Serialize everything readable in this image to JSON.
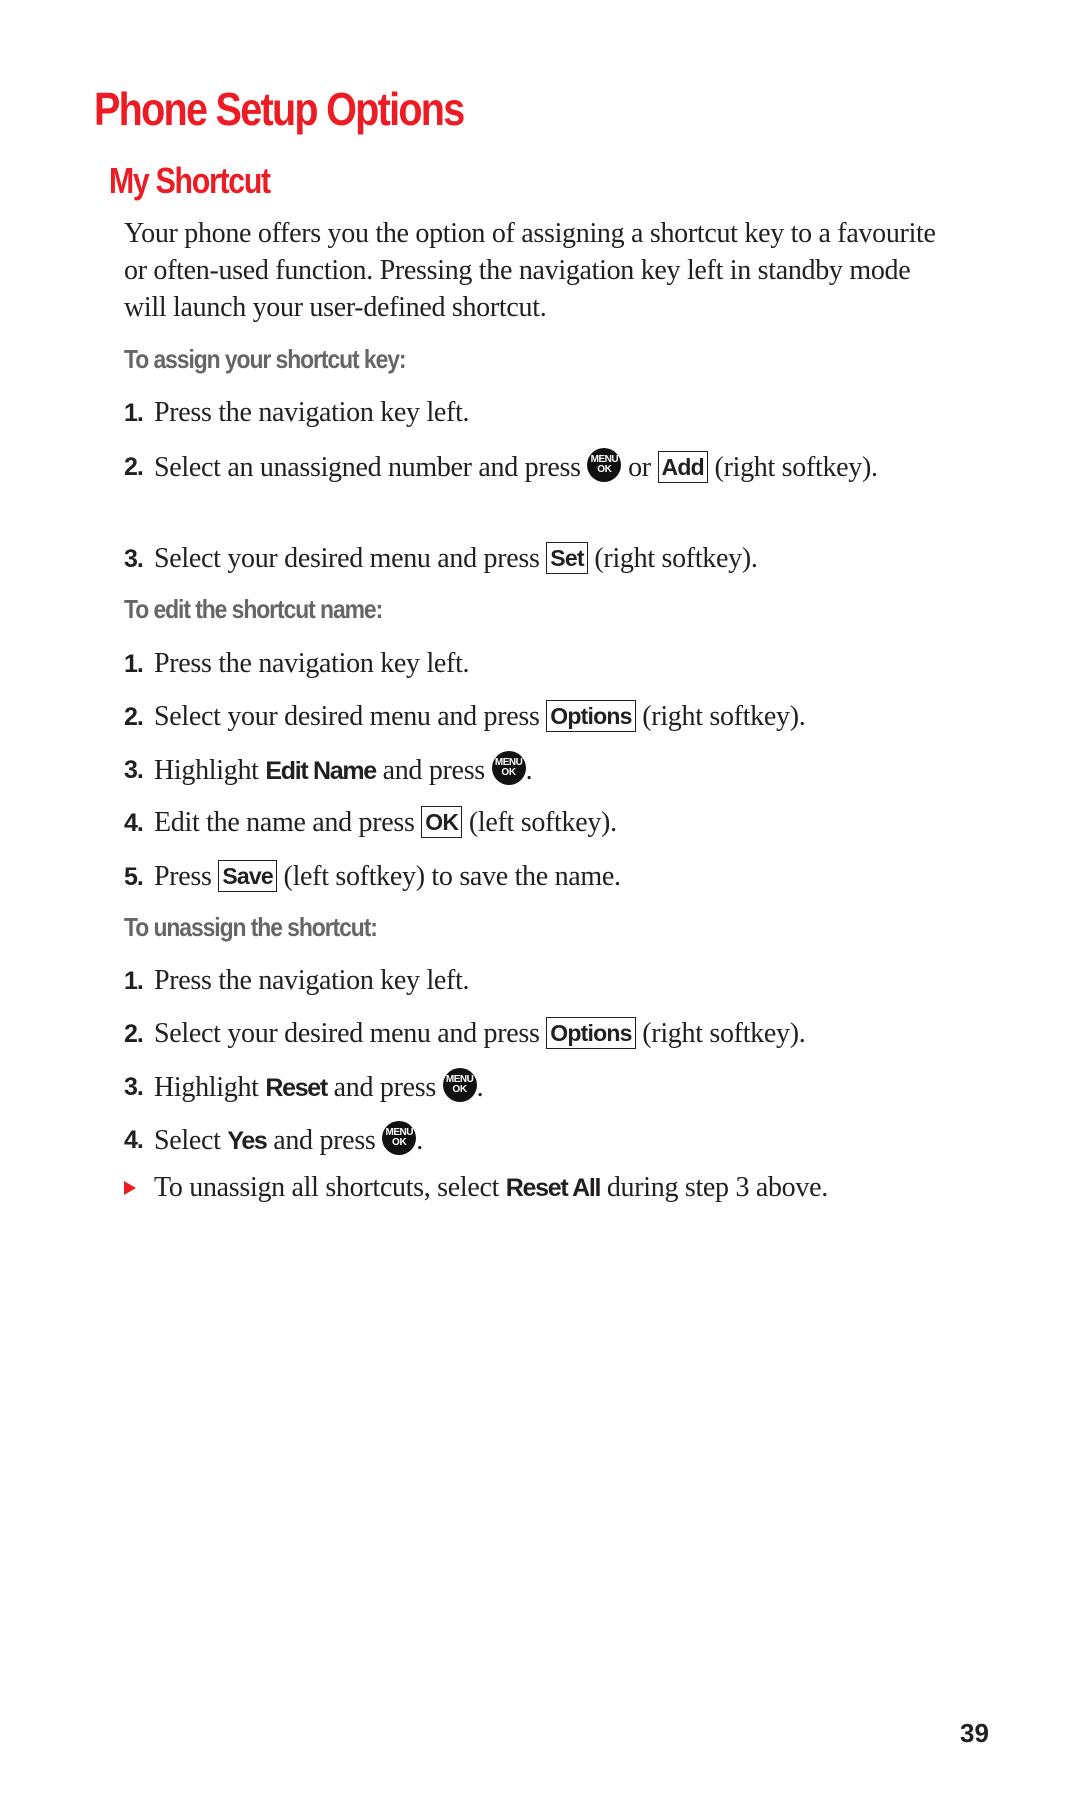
{
  "page": {
    "title": "Phone Setup Options",
    "section_title": "My Shortcut",
    "intro": "Your phone offers you the option of assigning a shortcut key to a favourite or often-used function. Pressing the navigation key left in standby mode will launch your user-defined shortcut.",
    "page_number": "39",
    "accent_color": "#ED1C24",
    "subhead_color": "#666666"
  },
  "icons": {
    "menu_ok": {
      "name": "menu-ok-key-icon",
      "line1": "MENU",
      "line2": "OK"
    },
    "bullet": "red-triangle-bullet-icon"
  },
  "assign": {
    "heading": "To assign your shortcut key:",
    "steps": [
      {
        "num": "1.",
        "text": "Press the navigation key left."
      },
      {
        "num": "2.",
        "before": "Select an unassigned number and press",
        "mid": "or",
        "softkey": "Add",
        "after": "(right softkey)."
      },
      {
        "num": "3.",
        "before": "Select your desired menu and press",
        "softkey": "Set",
        "after": "(right softkey)."
      }
    ]
  },
  "edit": {
    "heading": "To edit the shortcut name:",
    "steps": [
      {
        "num": "1.",
        "text": "Press the navigation key left."
      },
      {
        "num": "2.",
        "before": "Select your desired menu and press",
        "softkey": "Options",
        "after": "(right softkey)."
      },
      {
        "num": "3.",
        "before": "Highlight",
        "bold": "Edit Name",
        "after": "and press",
        "end": "."
      },
      {
        "num": "4.",
        "before": "Edit the name and press",
        "softkey": "OK",
        "after": "(left softkey)."
      },
      {
        "num": "5.",
        "before": "Press",
        "softkey": "Save",
        "after": "(left softkey) to save the name."
      }
    ]
  },
  "unassign": {
    "heading": "To unassign the shortcut:",
    "steps": [
      {
        "num": "1.",
        "text": "Press the navigation key left."
      },
      {
        "num": "2.",
        "before": "Select your desired menu and press",
        "softkey": "Options",
        "after": "(right softkey)."
      },
      {
        "num": "3.",
        "before": "Highlight",
        "bold": "Reset",
        "after": "and press",
        "end": "."
      },
      {
        "num": "4.",
        "before": "Select",
        "bold": "Yes",
        "after": "and press",
        "end": "."
      }
    ],
    "note": {
      "before": "To unassign all shortcuts, select",
      "bold": "Reset All",
      "after": "during step 3 above."
    }
  }
}
